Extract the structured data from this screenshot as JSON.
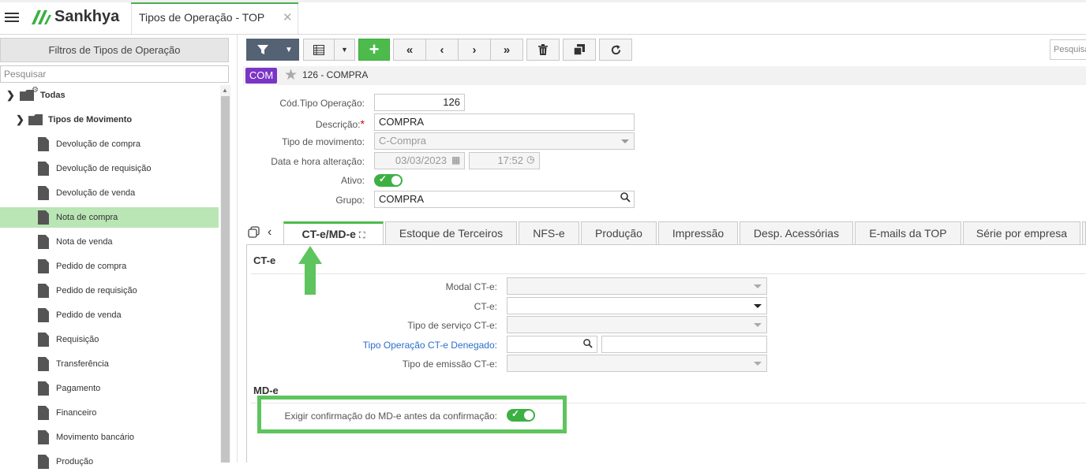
{
  "app": {
    "logo": "Sankhya",
    "tab_title": "Tipos de Operação - TOP"
  },
  "left_panel": {
    "header": "Filtros de Tipos de Operação",
    "search_placeholder": "Pesquisar",
    "root": "Todas",
    "group": "Tipos de Movimento",
    "items": [
      "Devolução de compra",
      "Devolução de requisição",
      "Devolução de venda",
      "Nota de compra",
      "Nota de venda",
      "Pedido de compra",
      "Pedido de requisição",
      "Pedido de venda",
      "Requisição",
      "Transferência",
      "Pagamento",
      "Financeiro",
      "Movimento bancário",
      "Produção"
    ],
    "selected_index": 3
  },
  "toolbar": {
    "search_placeholder": "Pesquisar"
  },
  "record": {
    "badge": "COM",
    "title": "126 - COMPRA"
  },
  "form": {
    "cod_label": "Cód.Tipo Operação:",
    "cod_value": "126",
    "desc_label": "Descrição:",
    "desc_required": "*",
    "desc_value": "COMPRA",
    "tipo_mov_label": "Tipo de movimento:",
    "tipo_mov_value": "C-Compra",
    "data_label": "Data e hora alteração:",
    "data_value": "03/03/2023",
    "hora_value": "17:52",
    "ativo_label": "Ativo:",
    "grupo_label": "Grupo:",
    "grupo_value": "COMPRA"
  },
  "tabs": [
    "CT-e/MD-e",
    "Estoque de Terceiros",
    "NFS-e",
    "Produção",
    "Impressão",
    "Desp. Acessórias",
    "E-mails da TOP",
    "Série por empresa"
  ],
  "cte": {
    "section_title": "CT-e",
    "modal_label": "Modal CT-e:",
    "cte_label": "CT-e:",
    "tipo_servico_label": "Tipo de serviço CT-e:",
    "tipo_op_denegado_label": "Tipo Operação CT-e Denegado:",
    "tipo_emissao_label": "Tipo de emissão CT-e:"
  },
  "mde": {
    "section_title": "MD-e",
    "exigir_label": "Exigir confirmação do MD-e antes da confirmação:"
  },
  "colors": {
    "accent_green": "#4cbb4c",
    "badge_purple": "#7b35c6",
    "selected_row": "#b9e6b4",
    "highlight": "#5ec45e"
  }
}
